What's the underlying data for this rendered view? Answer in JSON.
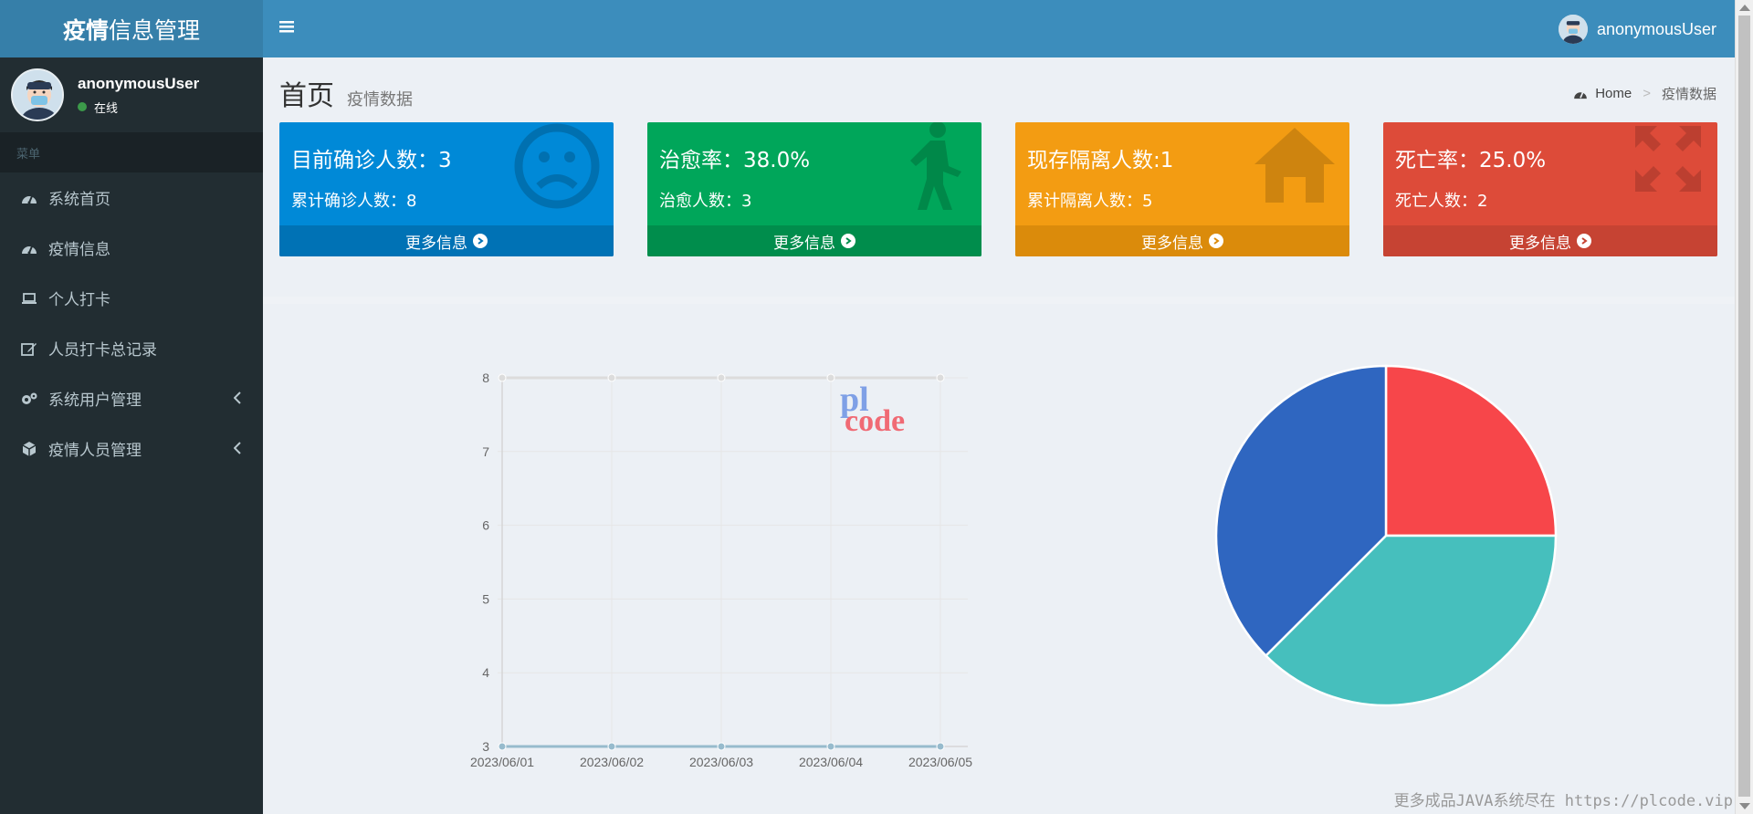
{
  "app": {
    "logo_bold": "疫情",
    "logo_rest": "信息管理"
  },
  "user": {
    "name": "anonymousUser",
    "status": "在线"
  },
  "sidebar": {
    "header": "菜单",
    "items": [
      {
        "label": "系统首页",
        "icon": "dashboard-icon"
      },
      {
        "label": "疫情信息",
        "icon": "dashboard-icon"
      },
      {
        "label": "个人打卡",
        "icon": "laptop-icon"
      },
      {
        "label": "人员打卡总记录",
        "icon": "edit-icon"
      },
      {
        "label": "系统用户管理",
        "icon": "gears-icon",
        "has_children": true
      },
      {
        "label": "疫情人员管理",
        "icon": "cube-icon",
        "has_children": true
      }
    ]
  },
  "header": {
    "menu_icon": "hamburger-icon",
    "user_name": "anonymousUser"
  },
  "page": {
    "title": "首页",
    "subtitle": "疫情数据"
  },
  "breadcrumb": {
    "home": "Home",
    "separator": ">",
    "current": "疫情数据"
  },
  "boxes": [
    {
      "title": "目前确诊人数：3",
      "sub": "累计确诊人数：8",
      "more": "更多信息",
      "icon": "frown-icon",
      "color": "#0089d7"
    },
    {
      "title": "治愈率：38.0%",
      "sub": "治愈人数：3",
      "more": "更多信息",
      "icon": "walking-person-icon",
      "color": "#00a65a"
    },
    {
      "title": "现存隔离人数:1",
      "sub": "累计隔离人数：5",
      "more": "更多信息",
      "icon": "home-icon",
      "color": "#f39c12"
    },
    {
      "title": "死亡率：25.0%",
      "sub": "死亡人数：2",
      "more": "更多信息",
      "icon": "expand-icon",
      "color": "#dd4b39"
    }
  ],
  "chart_data": [
    {
      "type": "line",
      "x": [
        "2023/06/01",
        "2023/06/02",
        "2023/06/03",
        "2023/06/04",
        "2023/06/05"
      ],
      "series": [
        {
          "values": [
            8,
            8,
            8,
            8,
            8
          ],
          "color": "#dcdcdc"
        },
        {
          "values": [
            3,
            3,
            3,
            3,
            3
          ],
          "color": "#97bbcd"
        }
      ],
      "ylim": [
        3,
        8
      ],
      "yticks": [
        3,
        4,
        5,
        6,
        7,
        8
      ],
      "grid": true
    },
    {
      "type": "pie",
      "values": [
        2,
        3,
        3
      ],
      "colors": [
        "#f7464a",
        "#46bfbd",
        "#2f66c0"
      ]
    }
  ],
  "watermark": {
    "logo_top": "pl",
    "logo_bottom": "code",
    "footer": "更多成品JAVA系统尽在 https://plcode.vip"
  }
}
